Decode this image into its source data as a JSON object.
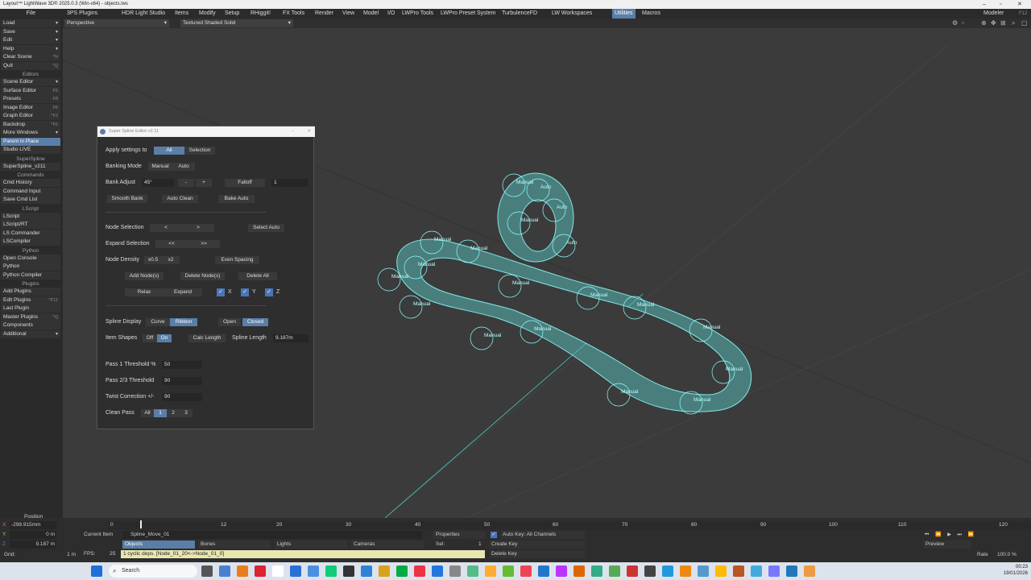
{
  "window": {
    "title": "Layout™ LightWave 3D® 2025.0.3 (Win-x64) - objects.lws"
  },
  "menubar": {
    "file": "File",
    "items": [
      "3PS Plugins",
      "HDR Light Studio",
      "Items",
      "Modify",
      "Setup",
      "RHiggit!",
      "FX Tools",
      "Render",
      "View",
      "Model",
      "I/O",
      "LWPro Tools",
      "LWPro Preset System",
      "TurbulenceFD",
      "LW Workspaces",
      "Utilities",
      "Macros"
    ],
    "modeler": "Modeler",
    "modeler_key": "F12"
  },
  "sidebar": {
    "items": [
      {
        "label": "Load",
        "dd": "▾"
      },
      {
        "label": "Save",
        "dd": "▾"
      },
      {
        "label": "Edit",
        "dd": "▾"
      },
      {
        "label": "Help",
        "dd": "▾"
      },
      {
        "label": "Clear Scene",
        "sc": "^N"
      },
      {
        "label": "Quit",
        "sc": "^Q"
      },
      {
        "header": "Editors"
      },
      {
        "label": "Scene Editor",
        "dd": "▾"
      },
      {
        "label": "Surface Editor",
        "sc": "F5"
      },
      {
        "label": "Presets",
        "sc": "F8"
      },
      {
        "label": "Image Editor",
        "sc": "F6"
      },
      {
        "label": "Graph Editor",
        "sc": "^F2"
      },
      {
        "label": "Backdrop",
        "sc": "^F5"
      },
      {
        "label": "More Windows",
        "dd": "▾"
      },
      {
        "label": "Parent in Place",
        "hl": true
      },
      {
        "label": "Studio LIVE"
      },
      {
        "header": "SuperSpline"
      },
      {
        "label": "SuperSpline_v211"
      },
      {
        "header": "Commands"
      },
      {
        "label": "Cmd History"
      },
      {
        "label": "Command Input"
      },
      {
        "label": "Save Cmd List"
      },
      {
        "header": "LScript"
      },
      {
        "label": "LScript"
      },
      {
        "label": "LScript/RT"
      },
      {
        "label": "LS Commander"
      },
      {
        "label": "LSCompiler"
      },
      {
        "header": "Python"
      },
      {
        "label": "Open Console"
      },
      {
        "label": "Python"
      },
      {
        "label": "Python Compiler"
      },
      {
        "header": "Plugins"
      },
      {
        "label": "Add Plugins"
      },
      {
        "label": "Edit Plugins",
        "sc": "^F11"
      },
      {
        "label": "Last Plugin"
      },
      {
        "label": "Master Plugins",
        "sc": "^Q"
      },
      {
        "label": "Components"
      },
      {
        "label": "Additional",
        "dd": "▾"
      }
    ]
  },
  "viewport": {
    "view": "Perspective",
    "shading": "Textured Shaded Solid"
  },
  "dialog": {
    "title": "Super Spline Editor v2.11",
    "apply_label": "Apply settings to",
    "apply_all": "All",
    "apply_sel": "Selection",
    "banking_label": "Banking Mode",
    "banking_manual": "Manual",
    "banking_auto": "Auto",
    "bank_adjust_label": "Bank Adjust",
    "bank_adjust_val": "45°",
    "minus": "-",
    "plus": "+",
    "falloff": "Falloff",
    "falloff_val": "1",
    "smooth_bank": "Smooth Bank",
    "auto_clean": "Auto Clean",
    "bake_auto": "Bake Auto",
    "node_sel_label": "Node Selection",
    "prev": "<",
    "next": ">",
    "select_auto": "Select Auto",
    "expand_sel_label": "Expand Selection",
    "shrink": "<<",
    "grow": ">>",
    "node_density_label": "Node Density",
    "x05": "x0.5",
    "x2": "x2",
    "even_spacing": "Even Spacing",
    "add_nodes": "Add Node(s)",
    "delete_nodes": "Delete Node(s)",
    "delete_all": "Delete All",
    "relax": "Relax",
    "expand": "Expand",
    "ax_x": "X",
    "ax_y": "Y",
    "ax_z": "Z",
    "spline_display_label": "Spline Display",
    "curve": "Curve",
    "ribbon": "Ribbon",
    "open": "Open",
    "closed": "Closed",
    "item_shapes_label": "Item Shapes",
    "off": "Off",
    "on": "On",
    "calc_length": "Calc Length",
    "spline_length_label": "Spline Length",
    "spline_length_val": "9.187m",
    "pass1_label": "Pass 1 Threshold %",
    "pass1_val": "50",
    "pass23_label": "Pass 2/3 Threshold",
    "pass23_val": "90",
    "twist_label": "Twist Correction +/-",
    "twist_val": "90",
    "clean_pass_label": "Clean Pass",
    "cp_all": "All",
    "cp1": "1",
    "cp2": "2",
    "cp3": "3"
  },
  "timeline": {
    "position_label": "Position",
    "x_label": "X",
    "x_val": "-298.915mm",
    "y_label": "Y",
    "y_val": "0 m",
    "z_label": "Z",
    "z_val": "9.187 m",
    "grid_label": "Grid:",
    "grid_val": "1 m",
    "ticks": [
      "0",
      "12",
      "20",
      "30",
      "40",
      "50",
      "60",
      "70",
      "80",
      "90",
      "100",
      "110",
      "120"
    ],
    "current_item_label": "Current Item",
    "current_item": "Spline_Move_01",
    "objects": "Objects",
    "bones": "Bones",
    "lights": "Lights",
    "cameras": "Cameras",
    "fps_label": "FPS:",
    "fps_val": "25",
    "status": "1 cyclic deps. [Node_01_20<->Node_01_0]",
    "properties": "Properties",
    "sel_label": "Sel:",
    "sel_val": "1",
    "auto_key": "Auto Key: All Channels",
    "create_key": "Create Key",
    "delete_key": "Delete Key",
    "preview": "Preview",
    "rate_label": "Rate",
    "rate_val": "100.0 %",
    "frame_start": "0",
    "frame_end": "120"
  },
  "taskbar": {
    "search": "Search",
    "time": "00:23",
    "date": "19/01/2026"
  },
  "spline_labels": [
    "Manual",
    "Manual",
    "Manual",
    "Manual",
    "Auto",
    "Auto",
    "Auto",
    "Manual",
    "Manual",
    "Manual",
    "Manual",
    "Manual",
    "Manual",
    "Manual",
    "Manual",
    "Manual",
    "Manual",
    "Manual",
    "Manual"
  ]
}
